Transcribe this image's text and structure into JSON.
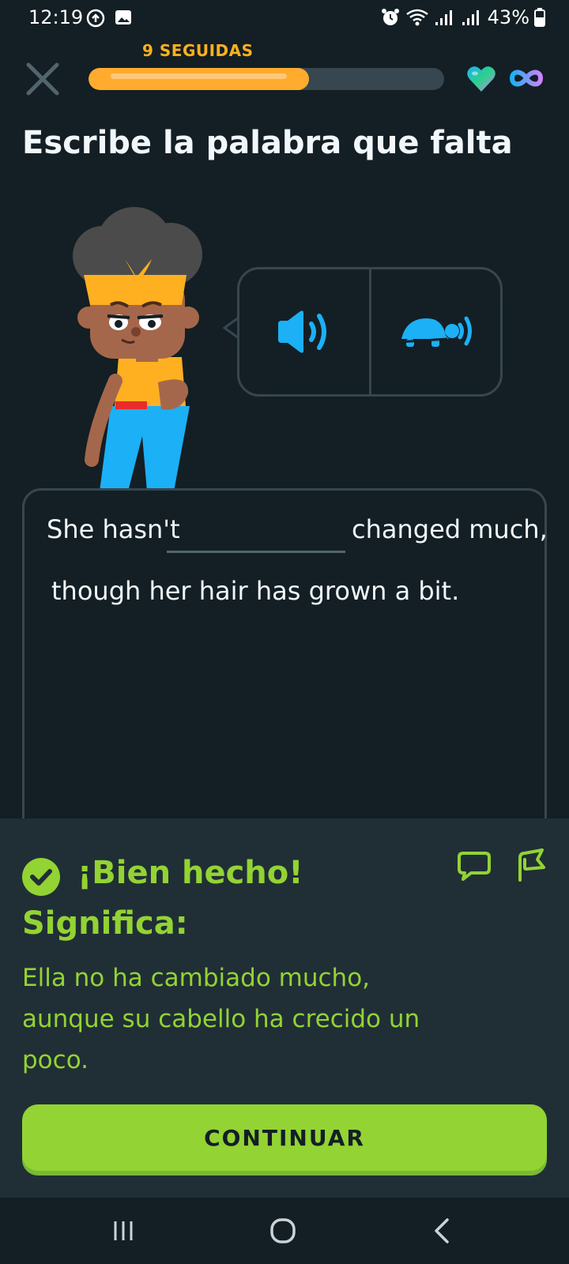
{
  "status_bar": {
    "time": "12:19",
    "battery": "43%"
  },
  "lesson": {
    "streak_label": "9 SEGUIDAS",
    "progress": 0.62,
    "hearts": "infinite"
  },
  "heading": "Escribe la palabra que falta",
  "audio": {
    "normal_icon": "speaker-icon",
    "slow_icon": "turtle-speaker-icon"
  },
  "sentence": {
    "before_blank": "She hasn't",
    "blank_value": "",
    "after_blank": "changed much,",
    "line2": "though her hair has grown a bit."
  },
  "feedback": {
    "title": "¡Bien hecho!",
    "meaning_label": "Significa:",
    "meaning_text": "Ella no ha cambiado mucho, aunque su cabello ha crecido un poco.",
    "continue_label": "CONTINUAR"
  },
  "colors": {
    "background": "#131f24",
    "panel": "#202f36",
    "green": "#93d333",
    "blue": "#1cb0f6",
    "orange": "#ffab2e",
    "border": "#37464f"
  }
}
